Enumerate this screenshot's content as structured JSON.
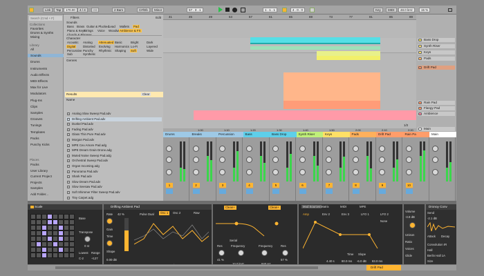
{
  "transport": {
    "link": "Link",
    "tap": "Tap",
    "tempo": "170.00",
    "time_sig": "4 / 4",
    "metro": "○○",
    "quant": "2 Bars",
    "key": "C#/Db",
    "scale": "Minor",
    "position": "57 . 3 . 1",
    "loop_start": "1 . 1 . 1",
    "loop_len": "4 . 0 . 0",
    "key_btn": "Key",
    "midi_btn": "MIDI",
    "sample_rate": "48.0 kHz",
    "cpu": "15 %"
  },
  "browser": {
    "search_placeholder": "Search (Cmd + F)",
    "collections_head": "Collections",
    "collections": [
      "Favorites",
      "Drums & Synths",
      "Mixing"
    ],
    "library_head": "Library",
    "library": [
      "All",
      "Sounds",
      "Drums",
      "Instruments",
      "Audio Effects",
      "MIDI Effects",
      "Max for Live",
      "Modulators",
      "Plug-Ins",
      "Clips",
      "Samples",
      "Grooves",
      "Tunings",
      "Templates",
      "Packs",
      "Punchy Kicks"
    ],
    "places_head": "Places",
    "places": [
      "Packs",
      "User Library",
      "Current Project",
      "Projects",
      "Samples",
      "Add Folder..."
    ],
    "filters_label": "Filters",
    "edit_label": "Edit",
    "sounds_label": "Sounds",
    "sound_tags": [
      "Bass",
      "Brass",
      "Guitar & Plucked",
      "Lead",
      "Mallets",
      "Pad",
      "Piano & Keys",
      "Strings",
      "Voice",
      "Woodwind",
      "Ambience & FX",
      "Chords & Phrases"
    ],
    "character_label": "Character",
    "character_tags": [
      "Acoustic",
      "Analog",
      "Attenuated",
      "Basic",
      "Bright",
      "Dark",
      "Digital",
      "Distorted",
      "Evolving",
      "Harmonics",
      "Lo-Fi",
      "Layered",
      "Percussive",
      "Punchy",
      "Rhythmic",
      "Shaping",
      "Soft",
      "Wide",
      "Sub",
      "Synthetic"
    ],
    "genres_label": "Genres",
    "results_label": "Results",
    "clear_label": "Clear",
    "name_col": "Name",
    "results": [
      "Analog Slow Sweep Pad.adv",
      "Drifting Ambient Pad.adv",
      "Dunkel Pad.adv",
      "Fading Pad.adv",
      "Glass Thin Pure Pad.adv",
      "Morgan Pad.adv",
      "MPE Cex Amore Pad.adg",
      "MPE Dream Grain Drone.adg",
      "Muted Noise Sweep Pad.adg",
      "Orchestral Sweep Pad.adv",
      "Organ Incoming.adg",
      "Panorama Pad.adv",
      "Shark Pad.adv",
      "Slow Dream Pad.adv",
      "Slow Seesaw Pad.adv",
      "Soft Shimmer Filter Sweep Pad.adv",
      "Tiny Carpet.adg"
    ]
  },
  "arrangement": {
    "ruler": [
      "41",
      "45",
      "49",
      "53",
      "57",
      "61",
      "65",
      "69",
      "73",
      "77",
      "81",
      "85",
      "89"
    ],
    "time_ruler": [
      "1:00",
      "1:10",
      "1:20",
      "1:30",
      "1:40",
      "1:50",
      "2:00",
      "2:10",
      "2:20"
    ],
    "zoom": "1/2"
  },
  "tracks": [
    {
      "name": "Bass Drop",
      "color": "#f4e04f"
    },
    {
      "name": "Synth Riser",
      "color": "#ffe066"
    },
    {
      "name": "Keys",
      "color": "#ffe066"
    },
    {
      "name": "Pads",
      "color": "#ffb05c"
    },
    {
      "name": "Drift Pad",
      "color": "#ff8c5a"
    },
    {
      "name": "Rain Pad",
      "color": "#ff8c5a"
    },
    {
      "name": "Flangy Pad",
      "color": "#ff8c5a"
    },
    {
      "name": "Ambience",
      "color": "#ff7a9a"
    },
    {
      "name": "Main",
      "color": "#ffffff"
    }
  ],
  "mixer": {
    "strips": [
      {
        "name": "Drums",
        "color": "#9ec9e6",
        "num": "1"
      },
      {
        "name": "Breaks",
        "color": "#9ec9e6",
        "num": "2"
      },
      {
        "name": "Percussion",
        "color": "#9ec9e6",
        "num": "3"
      },
      {
        "name": "Bass",
        "color": "#5ecfea",
        "num": "4"
      },
      {
        "name": "Bass Drop",
        "color": "#5ecfea",
        "num": "5"
      },
      {
        "name": "Synth Riser",
        "color": "#c0f07a",
        "num": "6"
      },
      {
        "name": "Keys",
        "color": "#ffe066",
        "num": "7"
      },
      {
        "name": "Pads",
        "color": "#ffb05c",
        "num": "8"
      },
      {
        "name": "Drift Pad",
        "color": "#ff9d6a",
        "num": "9"
      },
      {
        "name": "Rain Pa",
        "color": "#ff9d6a",
        "num": "10"
      },
      {
        "name": "Main",
        "color": "#ffffff",
        "num": ""
      }
    ]
  },
  "devices": {
    "scale": {
      "title": "Scale",
      "base_label": "Base",
      "transpose_label": "Transpose",
      "transpose_val": "0 st",
      "lowest_label": "Lowest",
      "range_label": "Range",
      "lowest_val": "C-2",
      "range_val": "+127"
    },
    "drift": {
      "title": "Drifting Ambient Pad",
      "osc1": "Osc 1",
      "osc2": "Osc 2",
      "rate": "Rate",
      "gain": "Gain",
      "time": "Time",
      "shape": "Shape",
      "raw": "Raw",
      "pulse": "Pulse Dual",
      "noise": "Noise",
      "fx_a": "FX 1 0.0 %",
      "fx_b": "FX 2 5.0 %",
      "semi": "Semi 0 st",
      "det": "Det 0 ct",
      "db": "0.00 dB",
      "amt": "42 %"
    },
    "filter": {
      "clean": "Clean+",
      "serial": "Serial",
      "res": "Res",
      "freq": "Frequency",
      "freq_val": "10.0 kHz",
      "q_val": "840 Hz",
      "res_val": "41 %",
      "pct": "57 %"
    },
    "mod": {
      "tabs": [
        "Mod Sources",
        "Matrix",
        "MIDI",
        "MPE"
      ],
      "sub": [
        "Amp",
        "Env 2",
        "Env 3",
        "LFO 1",
        "LFO 2"
      ],
      "time": "Time",
      "slope": "Slope",
      "none": "None",
      "vals": [
        "4.40 s",
        "80.0 ms",
        "-6.0 dB",
        "83.0 ms"
      ]
    },
    "voice": {
      "volume": "Volume",
      "vol_val": "-3.8 dB",
      "unison": "Unison",
      "ratio": "Ratio",
      "voices": "Voices",
      "glide": "Glide"
    },
    "convo": {
      "title": "Dronoy Conv",
      "send": "Send",
      "attack": "Attack",
      "decay": "Decay",
      "conv_ir": "Convolution IR",
      "hall": "Hall",
      "berlin": "Berlin Hall 1A",
      "size": "Size",
      "size_val": "-2.1 dB"
    }
  },
  "status": {
    "clip": "Drift Pad"
  }
}
